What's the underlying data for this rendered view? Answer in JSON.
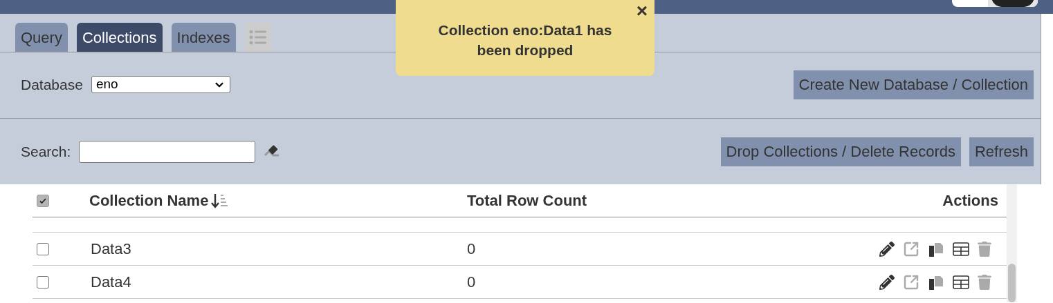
{
  "tabs": [
    {
      "label": "Query",
      "selected": false
    },
    {
      "label": "Collections",
      "selected": true
    },
    {
      "label": "Indexes",
      "selected": false
    }
  ],
  "database": {
    "label": "Database",
    "value": "eno"
  },
  "create_button": "Create New Database / Collection",
  "search": {
    "label": "Search:"
  },
  "buttons": [
    "Drop Collections / Delete Records",
    "Refresh"
  ],
  "table": {
    "select_all_checked": true,
    "columns": [
      "Collection Name",
      "Total Row Count",
      "Actions"
    ],
    "rows": [
      {
        "name": "Data3",
        "count": "0",
        "checked": false
      },
      {
        "name": "Data4",
        "count": "0",
        "checked": false
      }
    ]
  },
  "toast": {
    "message": "Collection eno:Data1 has been dropped",
    "close": "×"
  }
}
